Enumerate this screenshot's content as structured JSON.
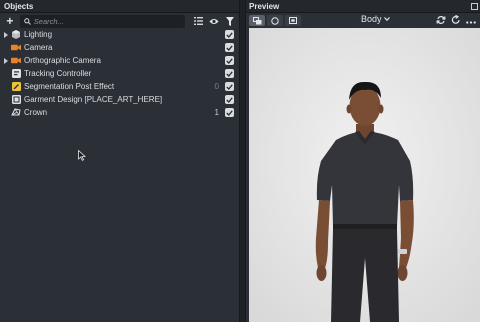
{
  "objects_panel": {
    "title": "Objects",
    "search": {
      "placeholder": "Search...",
      "value": ""
    },
    "items": [
      {
        "label": "Lighting",
        "icon": "lighting-group-icon",
        "expandable": true,
        "count": "",
        "checked": true
      },
      {
        "label": "Camera",
        "icon": "camera-icon",
        "expandable": false,
        "count": "",
        "checked": true
      },
      {
        "label": "Orthographic Camera",
        "icon": "camera-icon",
        "expandable": true,
        "count": "",
        "checked": true
      },
      {
        "label": "Tracking Controller",
        "icon": "tracking-controller-icon",
        "expandable": false,
        "count": "",
        "checked": true
      },
      {
        "label": "Segmentation Post Effect",
        "icon": "post-effect-icon",
        "expandable": false,
        "count": "0",
        "checked": true
      },
      {
        "label": "Garment Design [PLACE_ART_HERE]",
        "icon": "garment-design-icon",
        "expandable": false,
        "count": "",
        "checked": true
      },
      {
        "label": "Crown",
        "icon": "mesh-icon",
        "expandable": false,
        "count": "1",
        "checked": true
      }
    ]
  },
  "preview_panel": {
    "title": "Preview",
    "selection": "Body",
    "colors": {
      "background": "#e9e9e9",
      "shirt": "#34353a",
      "skin": "#7a4e35"
    }
  }
}
